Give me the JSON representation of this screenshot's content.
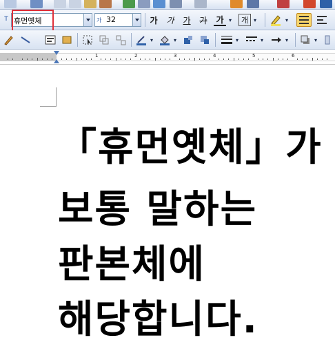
{
  "toolbar": {
    "font_name": "휴먼옛체",
    "font_size": "32",
    "font_size_prefix": "가",
    "char_buttons": [
      "가",
      "가",
      "가",
      "가",
      "가",
      "개"
    ],
    "icons_row1": [
      "paste-icon",
      "format-painter-icon",
      "find-icon",
      "cut-icon",
      "copy-icon",
      "table-icon"
    ],
    "icons_row2": [
      "pen-icon",
      "shape-icon",
      "text-box-icon",
      "align-icon",
      "fill-icon",
      "line-icon"
    ]
  },
  "ruler": {
    "labels": [
      "1",
      "2",
      "3",
      "4",
      "5",
      "6"
    ]
  },
  "document": {
    "lines": [
      "「휴먼옛체」가",
      "보통 말하는",
      "판본체에",
      "해당합니다."
    ]
  },
  "colors": {
    "highlight_box": "#e0303a",
    "toolbar_gradient_top": "#f4f7fc",
    "toolbar_gradient_bottom": "#d9e3f2",
    "active_button": "#f7d56a"
  }
}
